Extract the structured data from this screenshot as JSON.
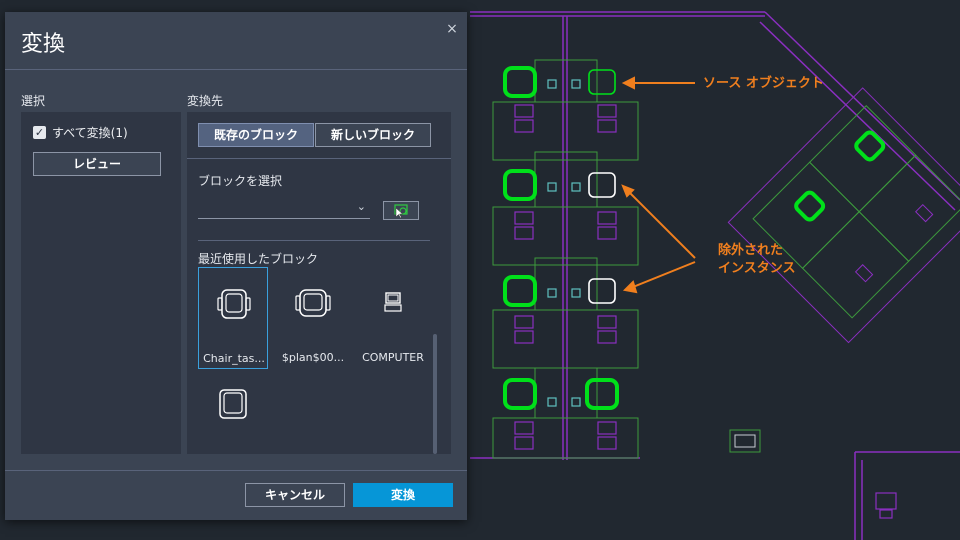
{
  "dialog": {
    "title": "変換",
    "close_glyph": "×",
    "selection_section": "選択",
    "convert_all_label": "すべて変換(1)",
    "convert_all_checked": true,
    "review_button": "レビュー",
    "target_section": "変換先",
    "tabs": [
      {
        "label": "既存のブロック",
        "active": true
      },
      {
        "label": "新しいブロック",
        "active": false
      }
    ],
    "block_select_label": "ブロックを選択",
    "dropdown_value": "",
    "recent_blocks_label": "最近使用したブロック",
    "recent_blocks": [
      {
        "name": "Chair_tas...",
        "icon": "task-chair-icon",
        "selected": true
      },
      {
        "name": "$plan$00...",
        "icon": "office-chair-icon",
        "selected": false
      },
      {
        "name": "COMPUTER",
        "icon": "computer-icon",
        "selected": false
      },
      {
        "name": "",
        "icon": "armchair-icon",
        "selected": false
      }
    ],
    "cancel_button": "キャンセル",
    "convert_button": "変換"
  },
  "annotations": {
    "source_object": "ソース オブジェクト",
    "excluded_line1": "除外された",
    "excluded_line2": "インスタンス"
  },
  "colors": {
    "accent": "#0696d7",
    "annotation": "#f07f1e",
    "cad_green": "#00e01a",
    "cad_magenta": "#9b34c9",
    "dialog_bg": "#3b4453",
    "canvas_bg": "#212830"
  }
}
